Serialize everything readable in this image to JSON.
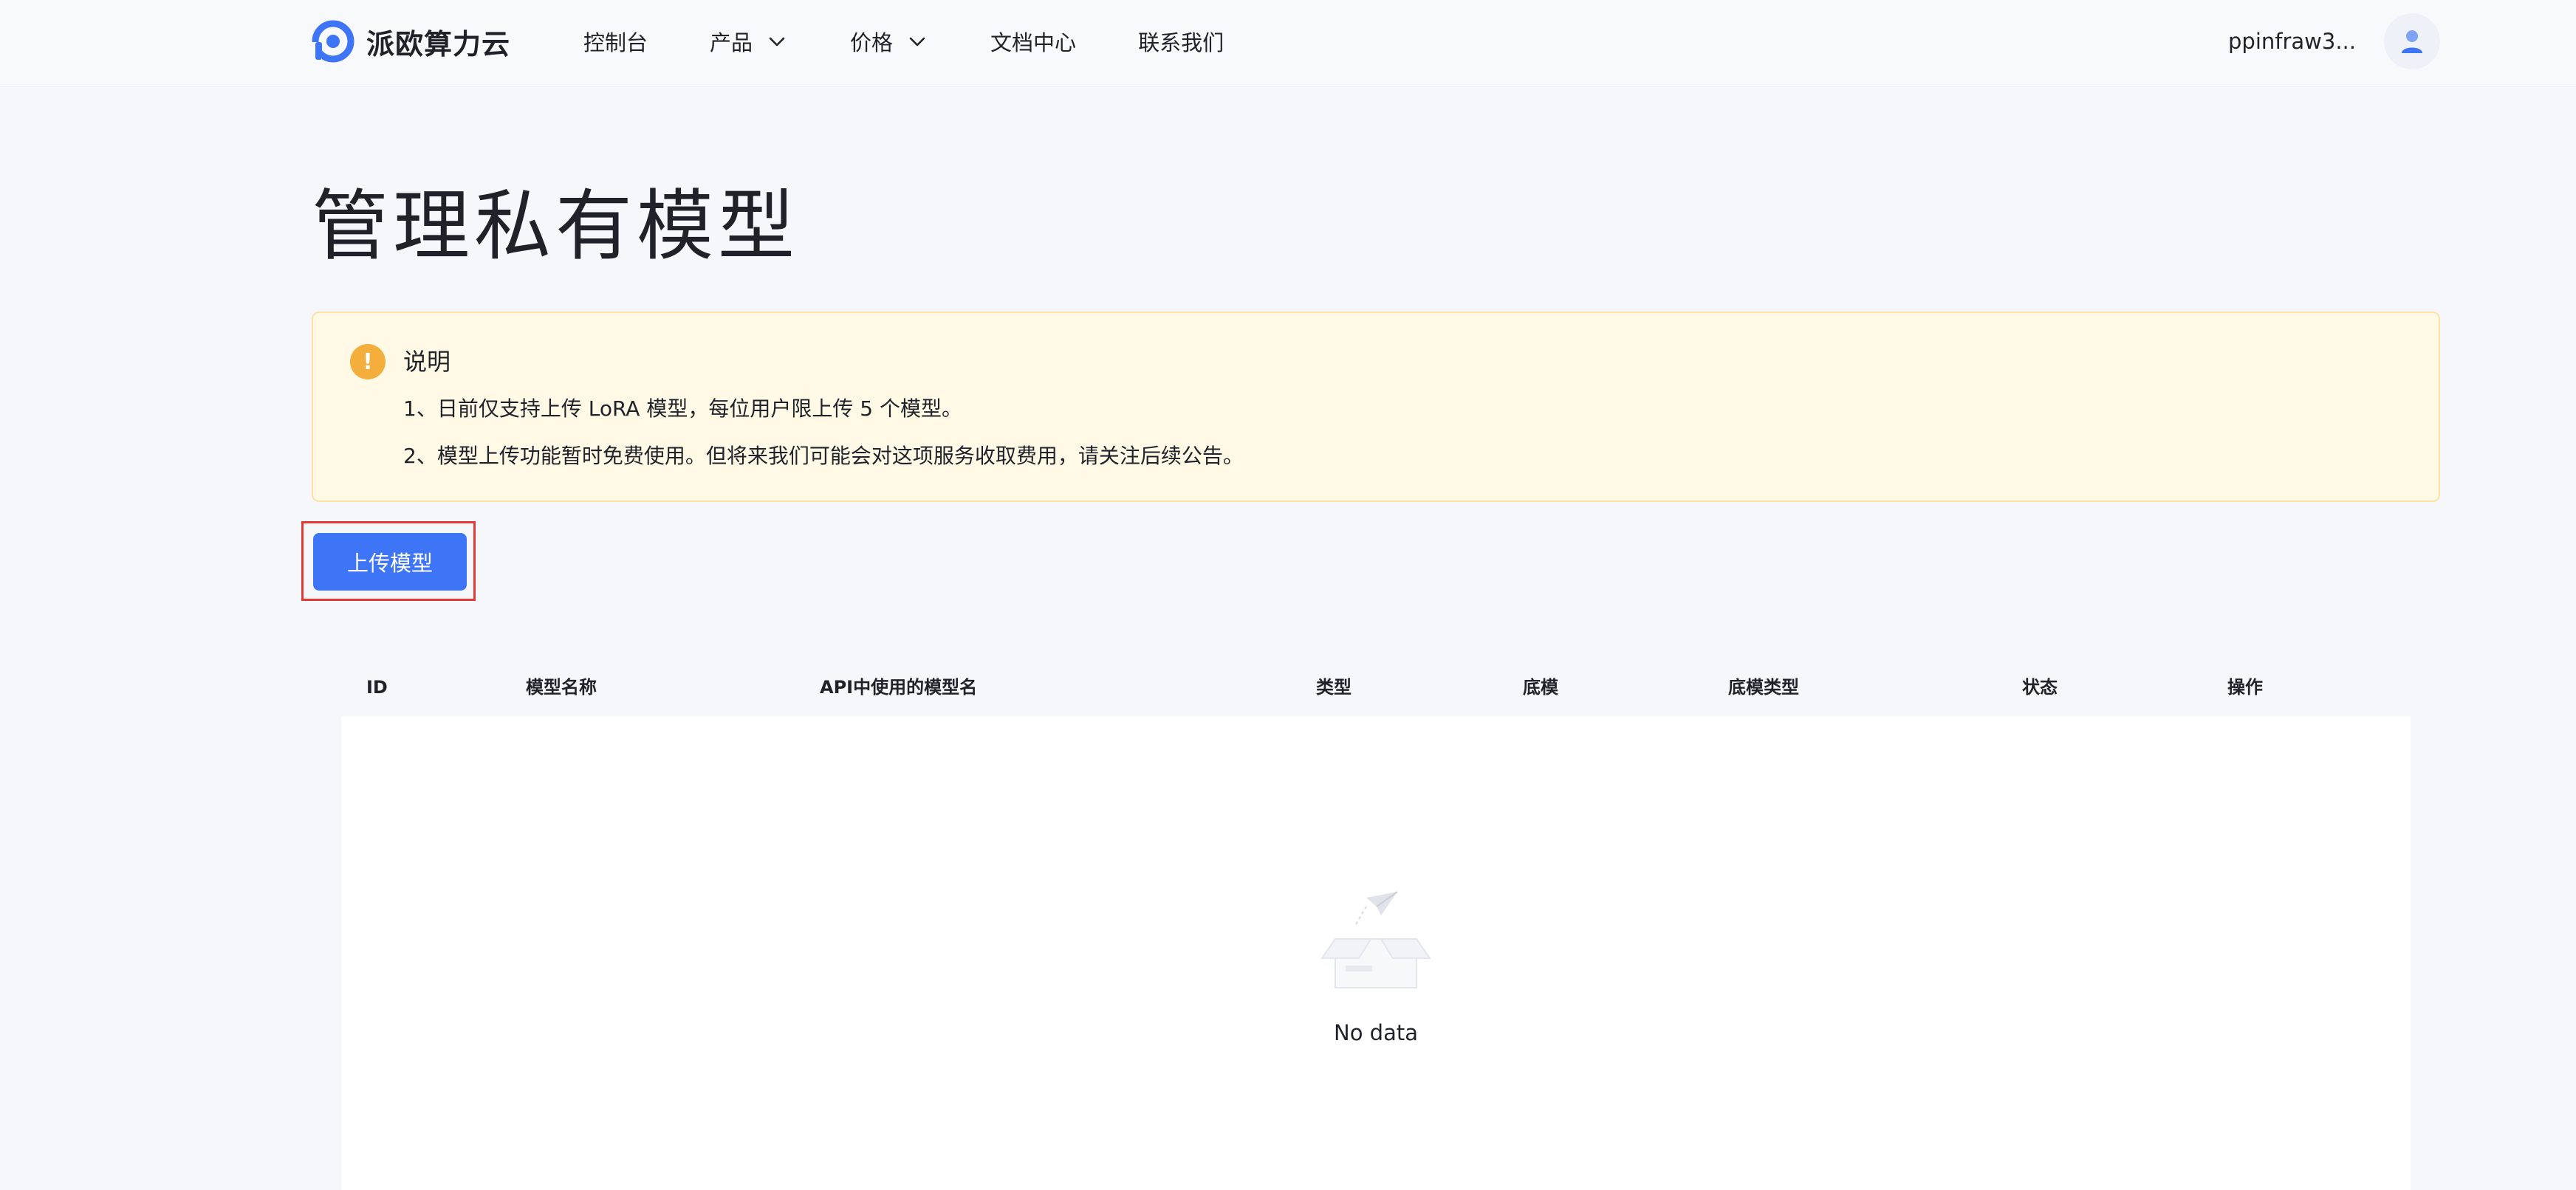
{
  "nav": {
    "brand_name": "派欧算力云",
    "menu": [
      {
        "label": "控制台",
        "has_dropdown": false
      },
      {
        "label": "产品",
        "has_dropdown": true
      },
      {
        "label": "价格",
        "has_dropdown": true
      },
      {
        "label": "文档中心",
        "has_dropdown": false
      },
      {
        "label": "联系我们",
        "has_dropdown": false
      }
    ],
    "user_name": "ppinfraw3..."
  },
  "page": {
    "title": "管理私有模型"
  },
  "notice": {
    "icon": "!",
    "title": "说明",
    "lines": [
      "1、日前仅支持上传 LoRA 模型，每位用户限上传 5 个模型。",
      "2、模型上传功能暂时免费使用。但将来我们可能会对这项服务收取费用，请关注后续公告。"
    ]
  },
  "actions": {
    "upload_label": "上传模型"
  },
  "table": {
    "columns": [
      "ID",
      "模型名称",
      "API中使用的模型名",
      "类型",
      "底模",
      "底模类型",
      "状态",
      "操作"
    ],
    "rows": [],
    "empty_text": "No data"
  },
  "colors": {
    "primary": "#3d75f6",
    "warning": "#f4ae3c",
    "notice_bg": "#fff9e6",
    "highlight_border": "#e53935"
  }
}
